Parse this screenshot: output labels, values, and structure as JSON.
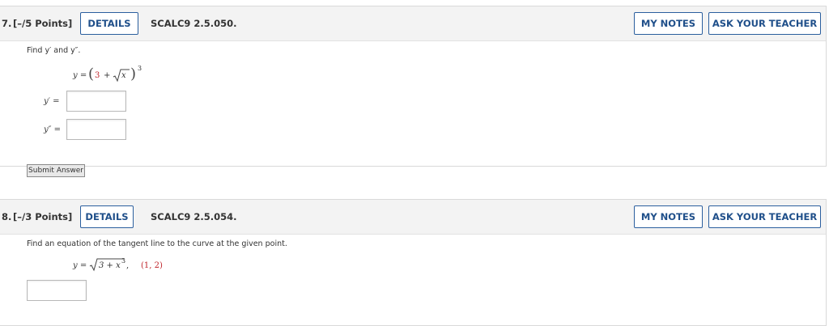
{
  "q7": {
    "number": "7.",
    "points": "[–/5 Points]",
    "details_label": "DETAILS",
    "code": "SCALC9 2.5.050.",
    "my_notes_label": "MY NOTES",
    "ask_teacher_label": "ASK YOUR TEACHER",
    "prompt": "Find y′ and y″.",
    "eq_lhs": "y =",
    "eq_const": "3",
    "eq_plus": "+",
    "eq_var": "x",
    "eq_exp": "3",
    "label_y1": "y′ =",
    "label_y2": "y″ =",
    "answer_y1": "",
    "answer_y2": "",
    "submit_label": "Submit Answer"
  },
  "q8": {
    "number": "8.",
    "points": "[–/3 Points]",
    "details_label": "DETAILS",
    "code": "SCALC9 2.5.054.",
    "my_notes_label": "MY NOTES",
    "ask_teacher_label": "ASK YOUR TEACHER",
    "prompt": "Find an equation of the tangent line to the curve at the given point.",
    "eq_lhs": "y =",
    "eq_radicand": "3 + x",
    "eq_exp": "3",
    "eq_comma": ",",
    "eq_point": "(1, 2)",
    "answer": ""
  },
  "colors": {
    "button_border": "#2b5f9e",
    "header_bg": "#f3f3f3",
    "highlight_red": "#c0262c"
  }
}
